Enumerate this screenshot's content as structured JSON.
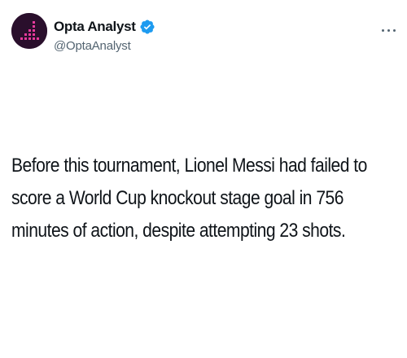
{
  "author": {
    "display_name": "Opta Analyst",
    "handle": "@OptaAnalyst",
    "verified": true,
    "avatar_icon": "opta-logo-icon",
    "avatar_bg": "#2a0f2c",
    "avatar_accent": "#e63a9c"
  },
  "menu": {
    "icon": "more-options-icon"
  },
  "tweet": {
    "text": "Before this tournament, Lionel Messi had failed to score a World Cup knockout stage goal in 756 minutes of action, despite attempting 23 shots."
  },
  "colors": {
    "verified": "#1d9bf0",
    "text": "#0f1419",
    "muted": "#536471"
  }
}
